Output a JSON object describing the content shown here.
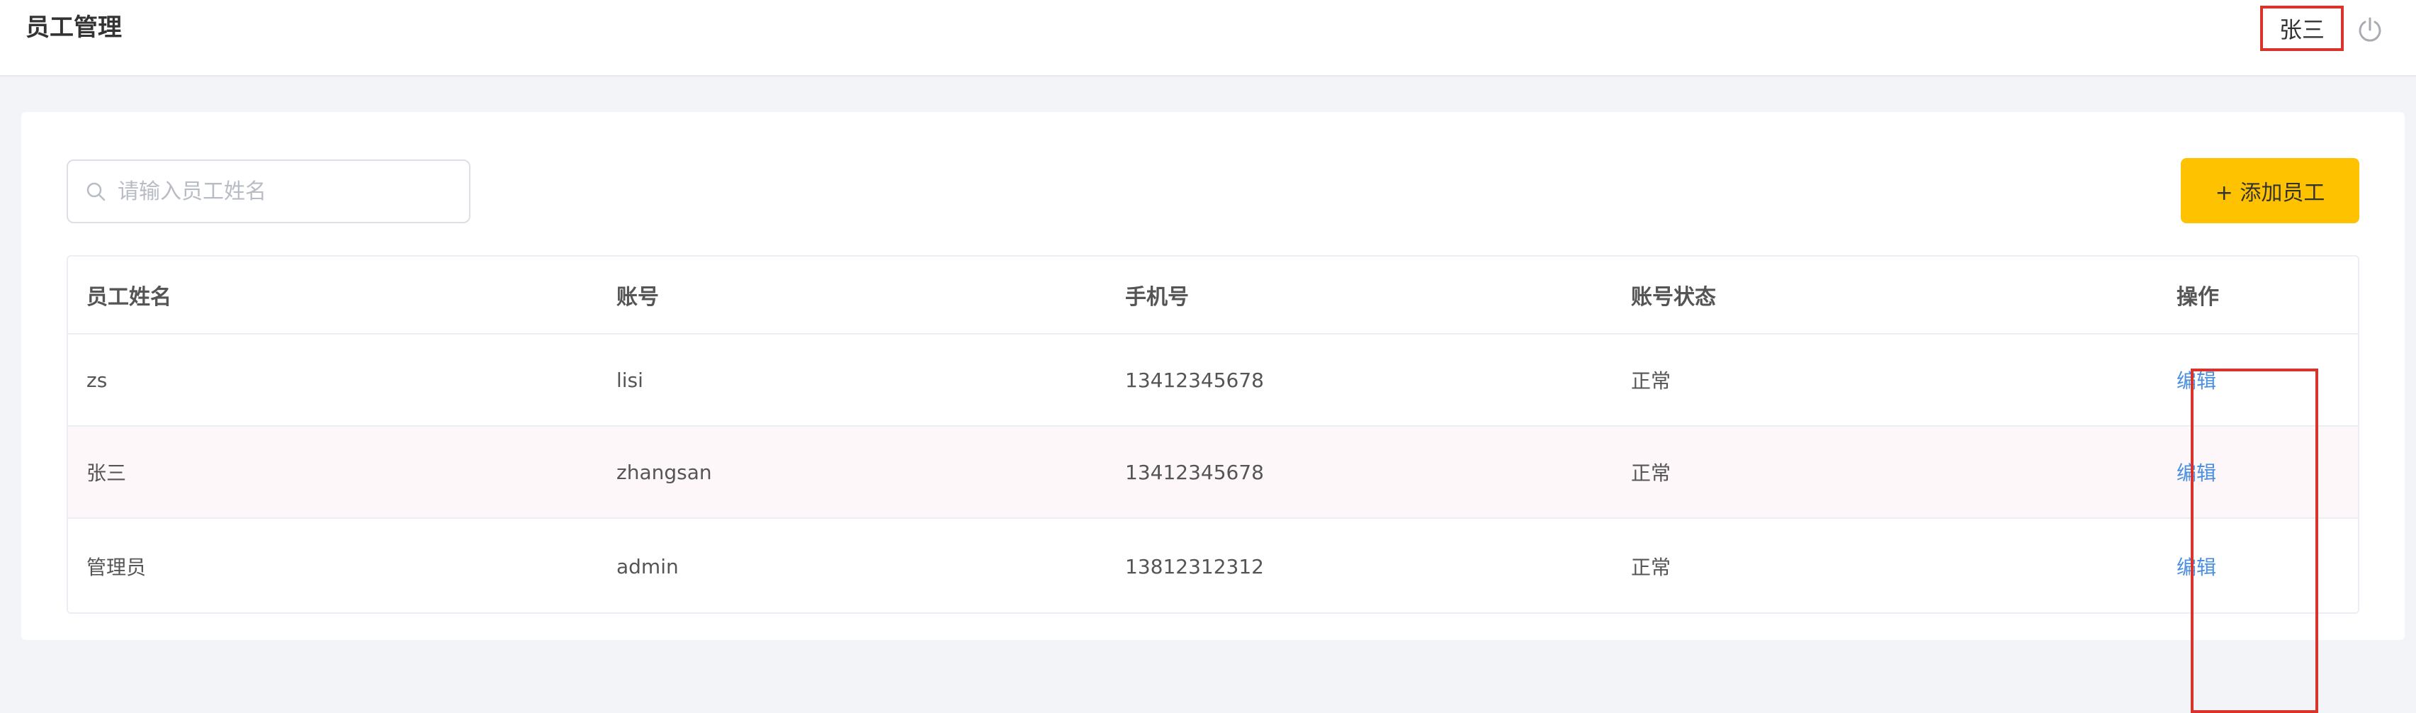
{
  "header": {
    "title": "员工管理",
    "user_name": "张三",
    "logout_icon": "power-icon"
  },
  "search": {
    "placeholder": "请输入员工姓名",
    "icon": "search-icon"
  },
  "actions": {
    "add_label": "+ 添加员工",
    "add_color": "#ffc200"
  },
  "table": {
    "columns": [
      "员工姓名",
      "账号",
      "手机号",
      "账号状态",
      "操作"
    ],
    "rows": [
      {
        "name": "zs",
        "account": "lisi",
        "phone": "13412345678",
        "status": "正常",
        "action": "编辑"
      },
      {
        "name": "张三",
        "account": "zhangsan",
        "phone": "13412345678",
        "status": "正常",
        "action": "编辑"
      },
      {
        "name": "管理员",
        "account": "admin",
        "phone": "13812312312",
        "status": "正常",
        "action": "编辑"
      }
    ]
  },
  "colors": {
    "highlight": "#d9342b",
    "link": "#4a90e2"
  }
}
